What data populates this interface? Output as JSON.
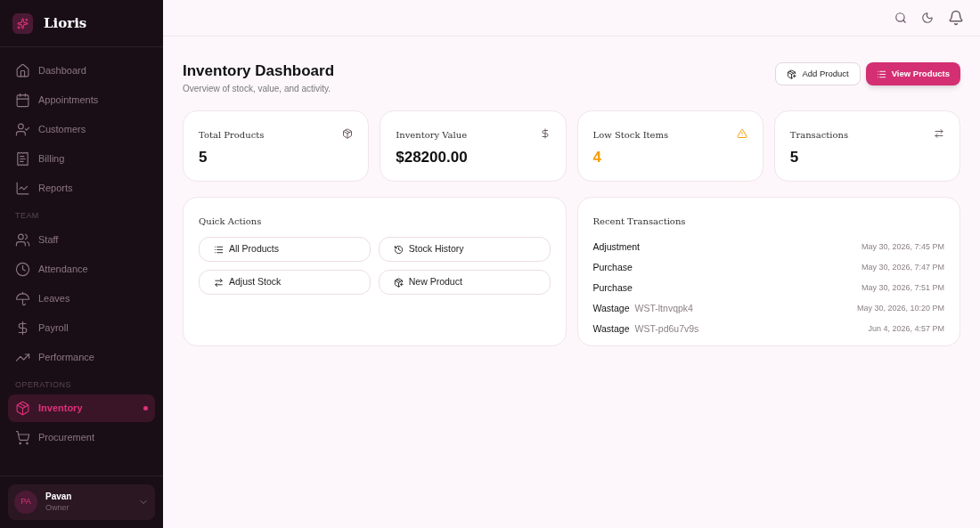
{
  "brand": {
    "name": "Lioris"
  },
  "sidebar": {
    "sections": [
      {
        "items": [
          {
            "label": "Dashboard",
            "selected": false
          },
          {
            "label": "Appointments",
            "selected": false
          },
          {
            "label": "Customers",
            "selected": false
          },
          {
            "label": "Billing",
            "selected": false
          },
          {
            "label": "Reports",
            "selected": false
          }
        ]
      },
      {
        "heading": "TEAM",
        "items": [
          {
            "label": "Staff",
            "selected": false
          },
          {
            "label": "Attendance",
            "selected": false
          },
          {
            "label": "Leaves",
            "selected": false
          },
          {
            "label": "Payroll",
            "selected": false
          },
          {
            "label": "Performance",
            "selected": false
          }
        ]
      },
      {
        "heading": "OPERATIONS",
        "items": [
          {
            "label": "Inventory",
            "selected": true
          },
          {
            "label": "Procurement",
            "selected": false
          }
        ]
      }
    ]
  },
  "user": {
    "initials": "PA",
    "name": "Pavan",
    "role": "Owner"
  },
  "page": {
    "title": "Inventory Dashboard",
    "subtitle": "Overview of stock, value, and activity.",
    "buttons": [
      "Add Product",
      "View Products"
    ]
  },
  "stats": [
    {
      "label": "Total Products",
      "value": "5",
      "warning": false
    },
    {
      "label": "Inventory Value",
      "value": "$28200.00",
      "warning": false
    },
    {
      "label": "Low Stock Items",
      "value": "4",
      "warning": true
    },
    {
      "label": "Transactions",
      "value": "5",
      "warning": false
    }
  ],
  "quick_actions": {
    "title": "Quick Actions",
    "buttons": [
      "All Products",
      "Stock History",
      "Adjust Stock",
      "New Product"
    ]
  },
  "recent_transactions": {
    "title": "Recent Transactions",
    "rows": [
      {
        "type": "Adjustment",
        "time": "May 30, 2026, 7:45 PM"
      },
      {
        "type": "Purchase",
        "time": "May 30, 2026, 7:47 PM"
      },
      {
        "type": "Purchase",
        "time": "May 30, 2026, 7:51 PM"
      },
      {
        "type": "Wastage",
        "reference": "WST-ltnvqpk4",
        "time": "May 30, 2026, 10:20 PM"
      },
      {
        "type": "Wastage",
        "reference": "WST-pd6u7v9s",
        "time": "Jun 4, 2026, 4:57 PM"
      }
    ]
  }
}
